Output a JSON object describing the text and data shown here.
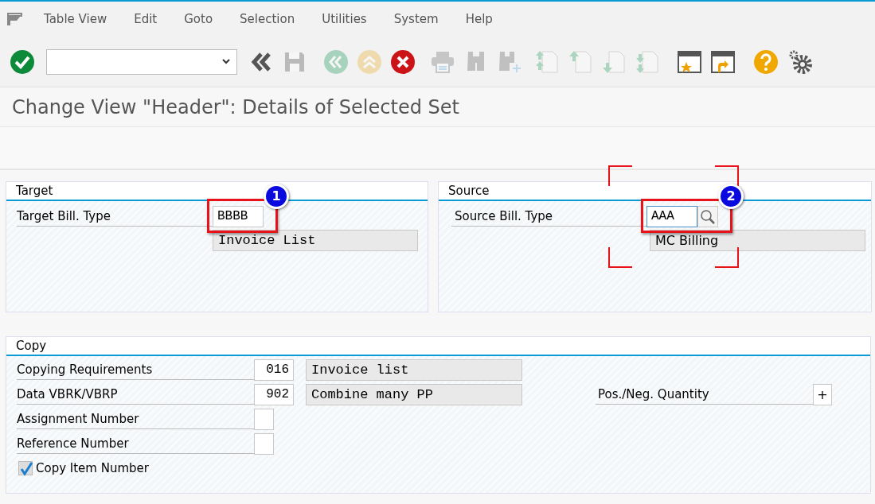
{
  "menu": [
    "Table View",
    "Edit",
    "Goto",
    "Selection",
    "Utilities",
    "System",
    "Help"
  ],
  "toolbar": [
    {
      "kind": "enter",
      "disabled": false
    },
    {
      "kind": "command_field",
      "disabled": false
    },
    {
      "kind": "collapse",
      "disabled": false
    },
    {
      "kind": "save",
      "disabled": true
    },
    {
      "kind": "back",
      "disabled": true
    },
    {
      "kind": "exit",
      "disabled": true
    },
    {
      "kind": "cancel",
      "disabled": false
    },
    {
      "kind": "print",
      "disabled": true
    },
    {
      "kind": "find",
      "disabled": true
    },
    {
      "kind": "find_next",
      "disabled": true
    },
    {
      "kind": "first_page",
      "disabled": true
    },
    {
      "kind": "previous_page",
      "disabled": true
    },
    {
      "kind": "next_page",
      "disabled": true
    },
    {
      "kind": "last_page",
      "disabled": true
    },
    {
      "kind": "new_window",
      "disabled": false
    },
    {
      "kind": "shortcut",
      "disabled": false
    },
    {
      "kind": "help",
      "disabled": false
    },
    {
      "kind": "settings",
      "disabled": false
    }
  ],
  "title": "Change View \"Header\": Details of Selected Set",
  "panels": [
    {
      "title": "Target",
      "field": {
        "label": "Target Bill. Type",
        "value": "BBBB",
        "description": "Invoice List",
        "description_mono": true,
        "search_help": false,
        "focused": false,
        "callout": "1"
      }
    },
    {
      "title": "Source",
      "field": {
        "label": "Source Bill. Type",
        "value": "AAA",
        "description": "MC Billing",
        "description_mono": false,
        "search_help": true,
        "focused": true,
        "callout": "2"
      }
    }
  ],
  "copy": {
    "title": "Copy",
    "rows": [
      {
        "kind": "field",
        "label": "Copying Requirements",
        "value": "016",
        "description": "Invoice list"
      },
      {
        "kind": "field",
        "label": "Data VBRK/VBRP",
        "value": "902",
        "description": "Combine many PP"
      },
      {
        "kind": "field",
        "label": "Assignment Number"
      },
      {
        "kind": "field",
        "label": "Reference Number"
      },
      {
        "kind": "checkbox",
        "label": "Copy Item Number",
        "checked": true
      }
    ],
    "side_field": {
      "label": "Pos./Neg. Quantity",
      "value": "+"
    }
  }
}
